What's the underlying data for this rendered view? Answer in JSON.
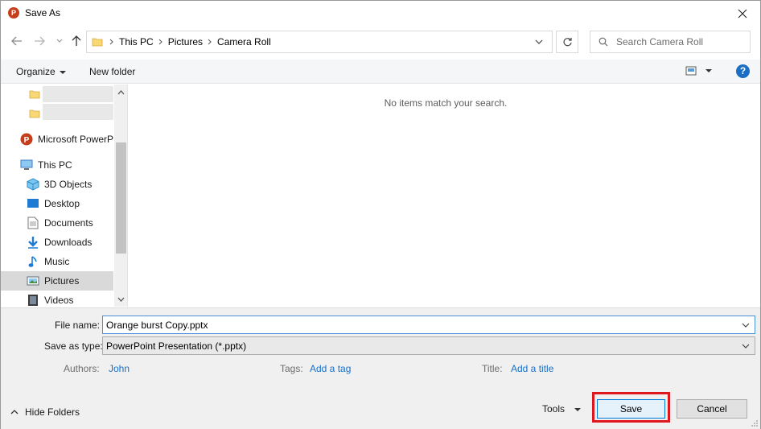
{
  "window": {
    "title": "Save As",
    "app_icon_letter": "P"
  },
  "nav": {
    "breadcrumbs": [
      "This PC",
      "Pictures",
      "Camera Roll"
    ],
    "search_placeholder": "Search Camera Roll"
  },
  "toolbar": {
    "organize_label": "Organize",
    "new_folder_label": "New folder",
    "help_label": "?"
  },
  "sidebar": {
    "items": [
      {
        "label": "Microsoft PowerP",
        "icon": "powerpoint-icon"
      },
      {
        "label": "This PC",
        "icon": "computer-icon"
      },
      {
        "label": "3D Objects",
        "icon": "3d-objects-icon"
      },
      {
        "label": "Desktop",
        "icon": "desktop-icon"
      },
      {
        "label": "Documents",
        "icon": "documents-icon"
      },
      {
        "label": "Downloads",
        "icon": "downloads-icon"
      },
      {
        "label": "Music",
        "icon": "music-icon"
      },
      {
        "label": "Pictures",
        "icon": "pictures-icon"
      },
      {
        "label": "Videos",
        "icon": "videos-icon"
      }
    ]
  },
  "content": {
    "empty_message": "No items match your search."
  },
  "form": {
    "file_name_label": "File name:",
    "file_name_value": "Orange burst Copy.pptx",
    "save_as_type_label": "Save as type:",
    "save_as_type_value": "PowerPoint Presentation (*.pptx)",
    "authors_label": "Authors:",
    "authors_value": "John",
    "tags_label": "Tags:",
    "tags_value": "Add a tag",
    "title_label": "Title:",
    "title_value": "Add a title"
  },
  "footer": {
    "hide_folders_label": "Hide Folders",
    "tools_label": "Tools",
    "save_label": "Save",
    "cancel_label": "Cancel"
  },
  "colors": {
    "accent": "#1a6fc4",
    "highlight_outline": "#e0161e",
    "powerpoint": "#c43e1c"
  }
}
